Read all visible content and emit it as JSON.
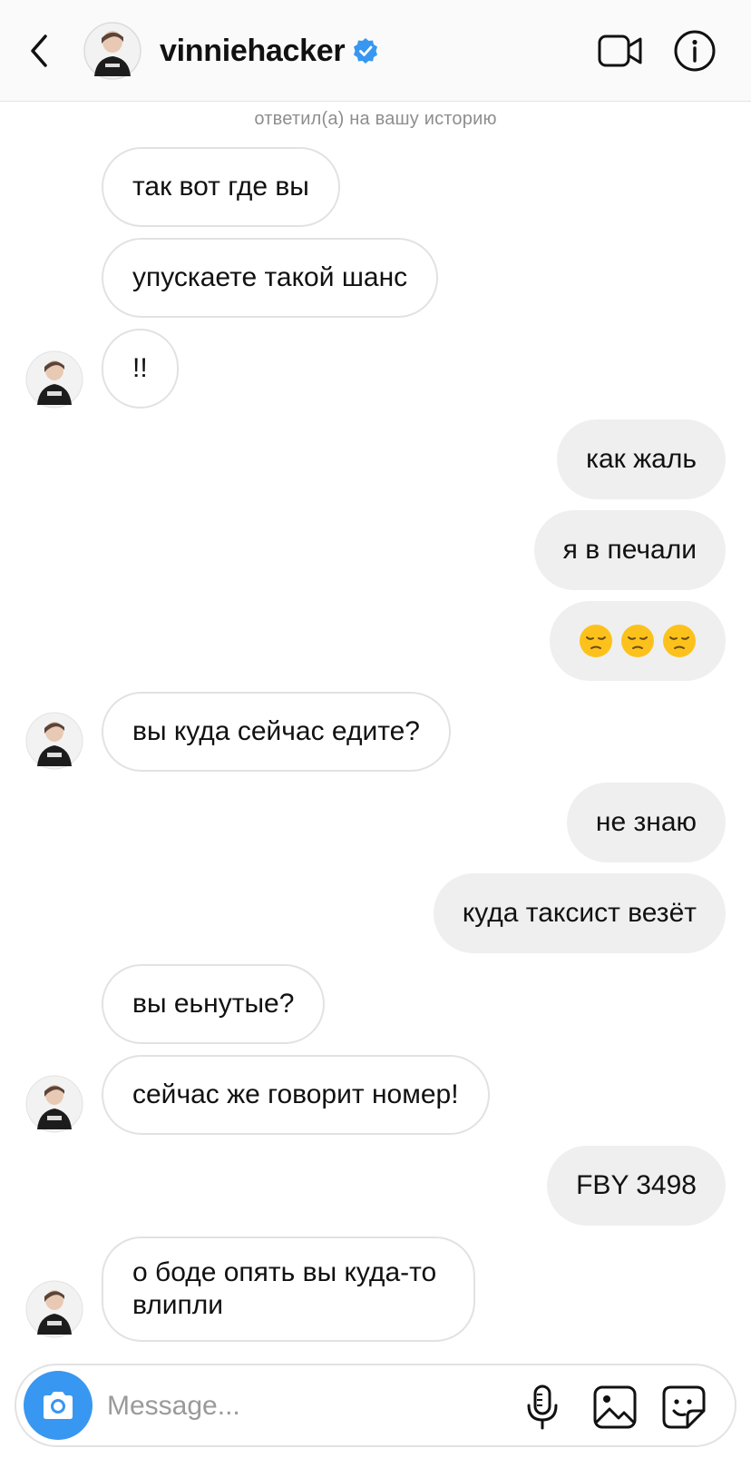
{
  "header": {
    "username": "vinniehacker",
    "verified": true,
    "back_icon": "chevron-left-icon",
    "video_icon": "video-camera-icon",
    "info_icon": "info-icon"
  },
  "story_note": "ответил(а) на вашу историю",
  "messages": [
    {
      "direction": "in",
      "text": "так вот где вы"
    },
    {
      "direction": "in",
      "text": "упускаете такой шанс"
    },
    {
      "direction": "in",
      "text": "!!"
    },
    {
      "direction": "out",
      "text": "как жаль"
    },
    {
      "direction": "out",
      "text": "я в печали"
    },
    {
      "direction": "out",
      "text": "",
      "emojis": [
        "pensive-face",
        "pensive-face",
        "pensive-face"
      ]
    },
    {
      "direction": "in",
      "text": "вы куда сейчас едите?"
    },
    {
      "direction": "out",
      "text": "не знаю"
    },
    {
      "direction": "out",
      "text": "куда таксист везёт"
    },
    {
      "direction": "in",
      "text": "вы еьнутые?"
    },
    {
      "direction": "in",
      "text": "сейчас же говорит номер!"
    },
    {
      "direction": "out",
      "text": "FBY 3498"
    },
    {
      "direction": "in",
      "text": "о боде опять вы куда-то влипли"
    }
  ],
  "composer": {
    "placeholder": "Message...",
    "icons": [
      "camera-icon",
      "microphone-icon",
      "gallery-icon",
      "sticker-icon"
    ]
  },
  "colors": {
    "accent": "#3897f0",
    "verified": "#3897f0",
    "outgoing_bubble": "#efefef",
    "incoming_border": "#e2e2e2"
  }
}
